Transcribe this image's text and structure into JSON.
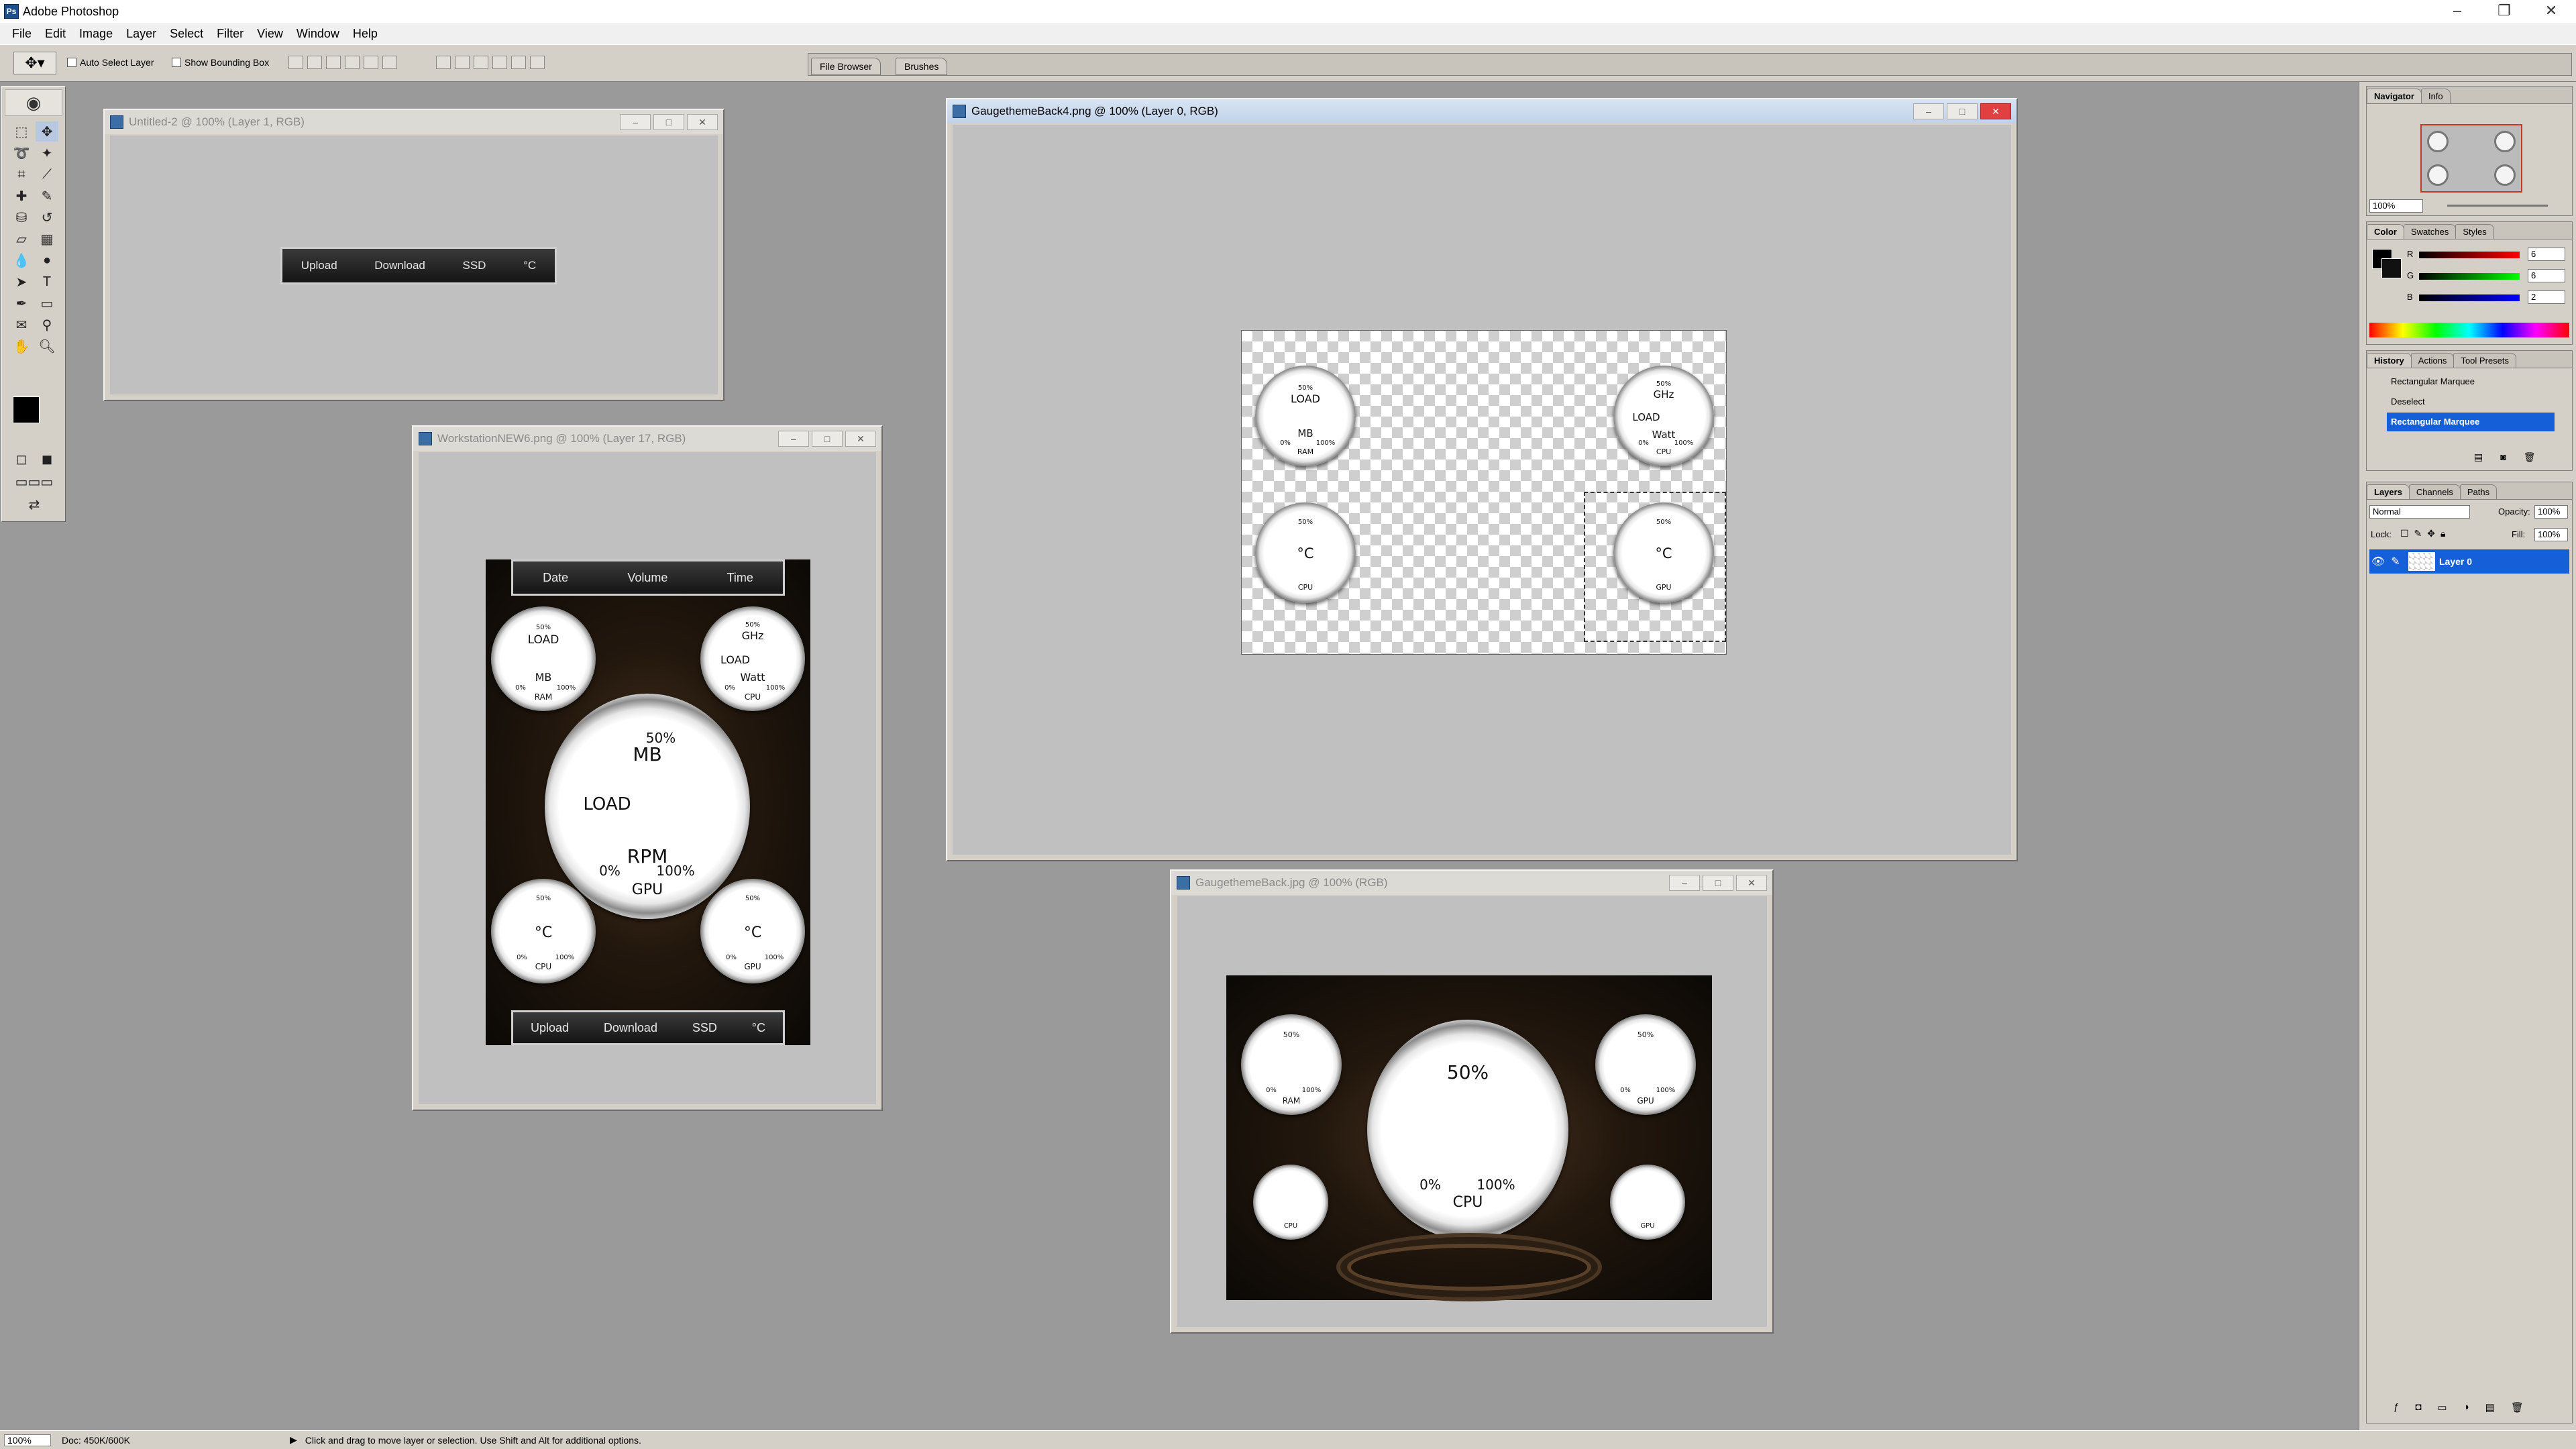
{
  "app": {
    "title": "Adobe Photoshop"
  },
  "menu": [
    "File",
    "Edit",
    "Image",
    "Layer",
    "Select",
    "Filter",
    "View",
    "Window",
    "Help"
  ],
  "options": {
    "auto_select": "Auto Select Layer",
    "show_bounding": "Show Bounding Box"
  },
  "well_tabs": [
    "File Browser",
    "Brushes"
  ],
  "windows": {
    "untitled": {
      "title": "Untitled-2 @ 100% (Layer 1, RGB)",
      "bar": [
        "Upload",
        "Download",
        "SSD",
        "°C"
      ]
    },
    "workstation": {
      "title": "WorkstationNEW6.png @ 100% (Layer 17, RGB)",
      "top_bar": [
        "Date",
        "Volume",
        "Time"
      ],
      "bottom_bar": [
        "Upload",
        "Download",
        "SSD",
        "°C"
      ],
      "g_ram": {
        "top": "LOAD",
        "bottom": "MB",
        "pct": "50%",
        "min": "0%",
        "max": "100%",
        "label": "RAM"
      },
      "g_cpu": {
        "top": "GHz",
        "mid": "LOAD",
        "bottom": "Watt",
        "pct": "50%",
        "min": "0%",
        "max": "100%",
        "label": "CPU"
      },
      "g_main": {
        "pct": "50%",
        "top": "MB",
        "mid": "LOAD",
        "bottom": "RPM",
        "min": "0%",
        "max": "100%",
        "label": "GPU"
      },
      "g_cpu_temp": {
        "text": "°C",
        "pct": "50%",
        "min": "0%",
        "max": "100%",
        "label": "CPU"
      },
      "g_gpu_temp": {
        "text": "°C",
        "pct": "50%",
        "min": "0%",
        "max": "100%",
        "label": "GPU"
      }
    },
    "back4": {
      "title": "GaugethemeBack4.png @ 100% (Layer 0, RGB)",
      "g_tl": {
        "pct": "50%",
        "top": "LOAD",
        "bottom": "MB",
        "min": "0%",
        "max": "100%",
        "label": "RAM"
      },
      "g_tr": {
        "pct": "50%",
        "top": "GHz",
        "mid": "LOAD",
        "bottom": "Watt",
        "min": "0%",
        "max": "100%",
        "label": "CPU"
      },
      "g_bl": {
        "pct": "50%",
        "text": "°C",
        "label": "CPU"
      },
      "g_br": {
        "pct": "50%",
        "text": "°C",
        "label": "GPU"
      }
    },
    "back": {
      "title": "GaugethemeBack.jpg @ 100% (RGB)",
      "g_ram": {
        "pct": "50%",
        "min": "0%",
        "max": "100%",
        "label": "RAM"
      },
      "g_gpu": {
        "pct": "50%",
        "min": "0%",
        "max": "100%",
        "label": "GPU"
      },
      "g_main": {
        "pct": "50%",
        "min": "0%",
        "max": "100%",
        "label": "CPU"
      },
      "g_cpu_s": {
        "label": "CPU"
      },
      "g_gpu_s": {
        "label": "GPU"
      }
    }
  },
  "navigator": {
    "tabs": [
      "Navigator",
      "Info"
    ],
    "zoom": "100%"
  },
  "color": {
    "tabs": [
      "Color",
      "Swatches",
      "Styles"
    ],
    "r_label": "R",
    "g_label": "G",
    "b_label": "B",
    "r": "6",
    "g": "6",
    "b": "2"
  },
  "history": {
    "tabs": [
      "History",
      "Actions",
      "Tool Presets"
    ],
    "items": [
      "Rectangular Marquee",
      "Deselect",
      "Rectangular Marquee"
    ]
  },
  "layers": {
    "tabs": [
      "Layers",
      "Channels",
      "Paths"
    ],
    "blend": "Normal",
    "opacity_label": "Opacity:",
    "opacity": "100%",
    "lock_label": "Lock:",
    "fill_label": "Fill:",
    "fill": "100%",
    "layer_name": "Layer 0"
  },
  "status": {
    "zoom": "100%",
    "doc": "Doc: 450K/600K",
    "hint": "Click and drag to move layer or selection.  Use Shift and Alt for additional options."
  }
}
